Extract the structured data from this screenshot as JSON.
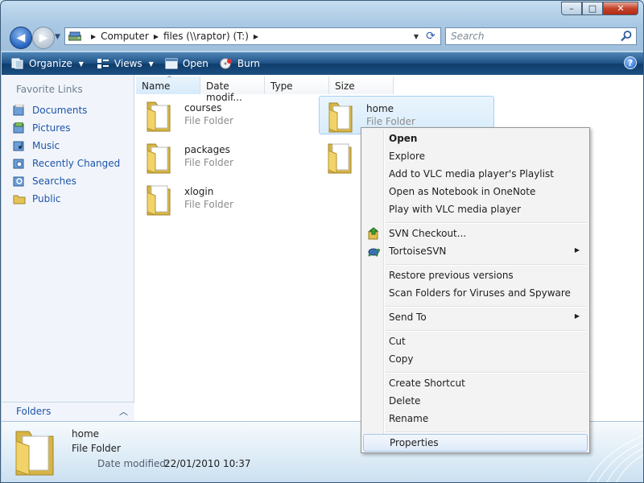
{
  "window": {
    "caption_buttons": [
      "–",
      "□",
      "✕"
    ]
  },
  "nav": {
    "breadcrumbs": [
      "Computer",
      "files (\\\\raptor) (T:)"
    ],
    "search_placeholder": "Search"
  },
  "toolbar": {
    "organize": "Organize",
    "views": "Views",
    "open": "Open",
    "burn": "Burn",
    "help": "?"
  },
  "sidebar": {
    "title": "Favorite Links",
    "items": [
      {
        "label": "Documents",
        "icon": "documents-icon"
      },
      {
        "label": "Pictures",
        "icon": "pictures-icon"
      },
      {
        "label": "Music",
        "icon": "music-icon"
      },
      {
        "label": "Recently Changed",
        "icon": "recently-changed-icon"
      },
      {
        "label": "Searches",
        "icon": "searches-icon"
      },
      {
        "label": "Public",
        "icon": "public-folder-icon"
      }
    ],
    "folders_label": "Folders"
  },
  "columns": [
    "Name",
    "Date modif...",
    "Type",
    "Size"
  ],
  "files": [
    {
      "name": "courses",
      "type": "File Folder"
    },
    {
      "name": "home",
      "type": "File Folder",
      "selected": true
    },
    {
      "name": "packages",
      "type": "File Folder"
    },
    {
      "name": "",
      "type": ""
    },
    {
      "name": "xlogin",
      "type": "File Folder"
    }
  ],
  "context_menu": {
    "groups": [
      [
        "Open",
        "Explore",
        "Add to VLC media player's Playlist",
        "Open as Notebook in OneNote",
        "Play with VLC media player"
      ],
      [
        "SVN Checkout...",
        "TortoiseSVN"
      ],
      [
        "Restore previous versions",
        "Scan Folders for Viruses and Spyware"
      ],
      [
        "Send To"
      ],
      [
        "Cut",
        "Copy"
      ],
      [
        "Create Shortcut",
        "Delete",
        "Rename"
      ],
      [
        "Properties"
      ]
    ]
  },
  "details": {
    "name": "home",
    "type": "File Folder",
    "date_label": "Date modified:",
    "date_value": "22/01/2010 10:37"
  },
  "colors": {
    "accent": "#1e54a8",
    "toolbar": "#1f5387",
    "selection": "#d8ecfb"
  }
}
